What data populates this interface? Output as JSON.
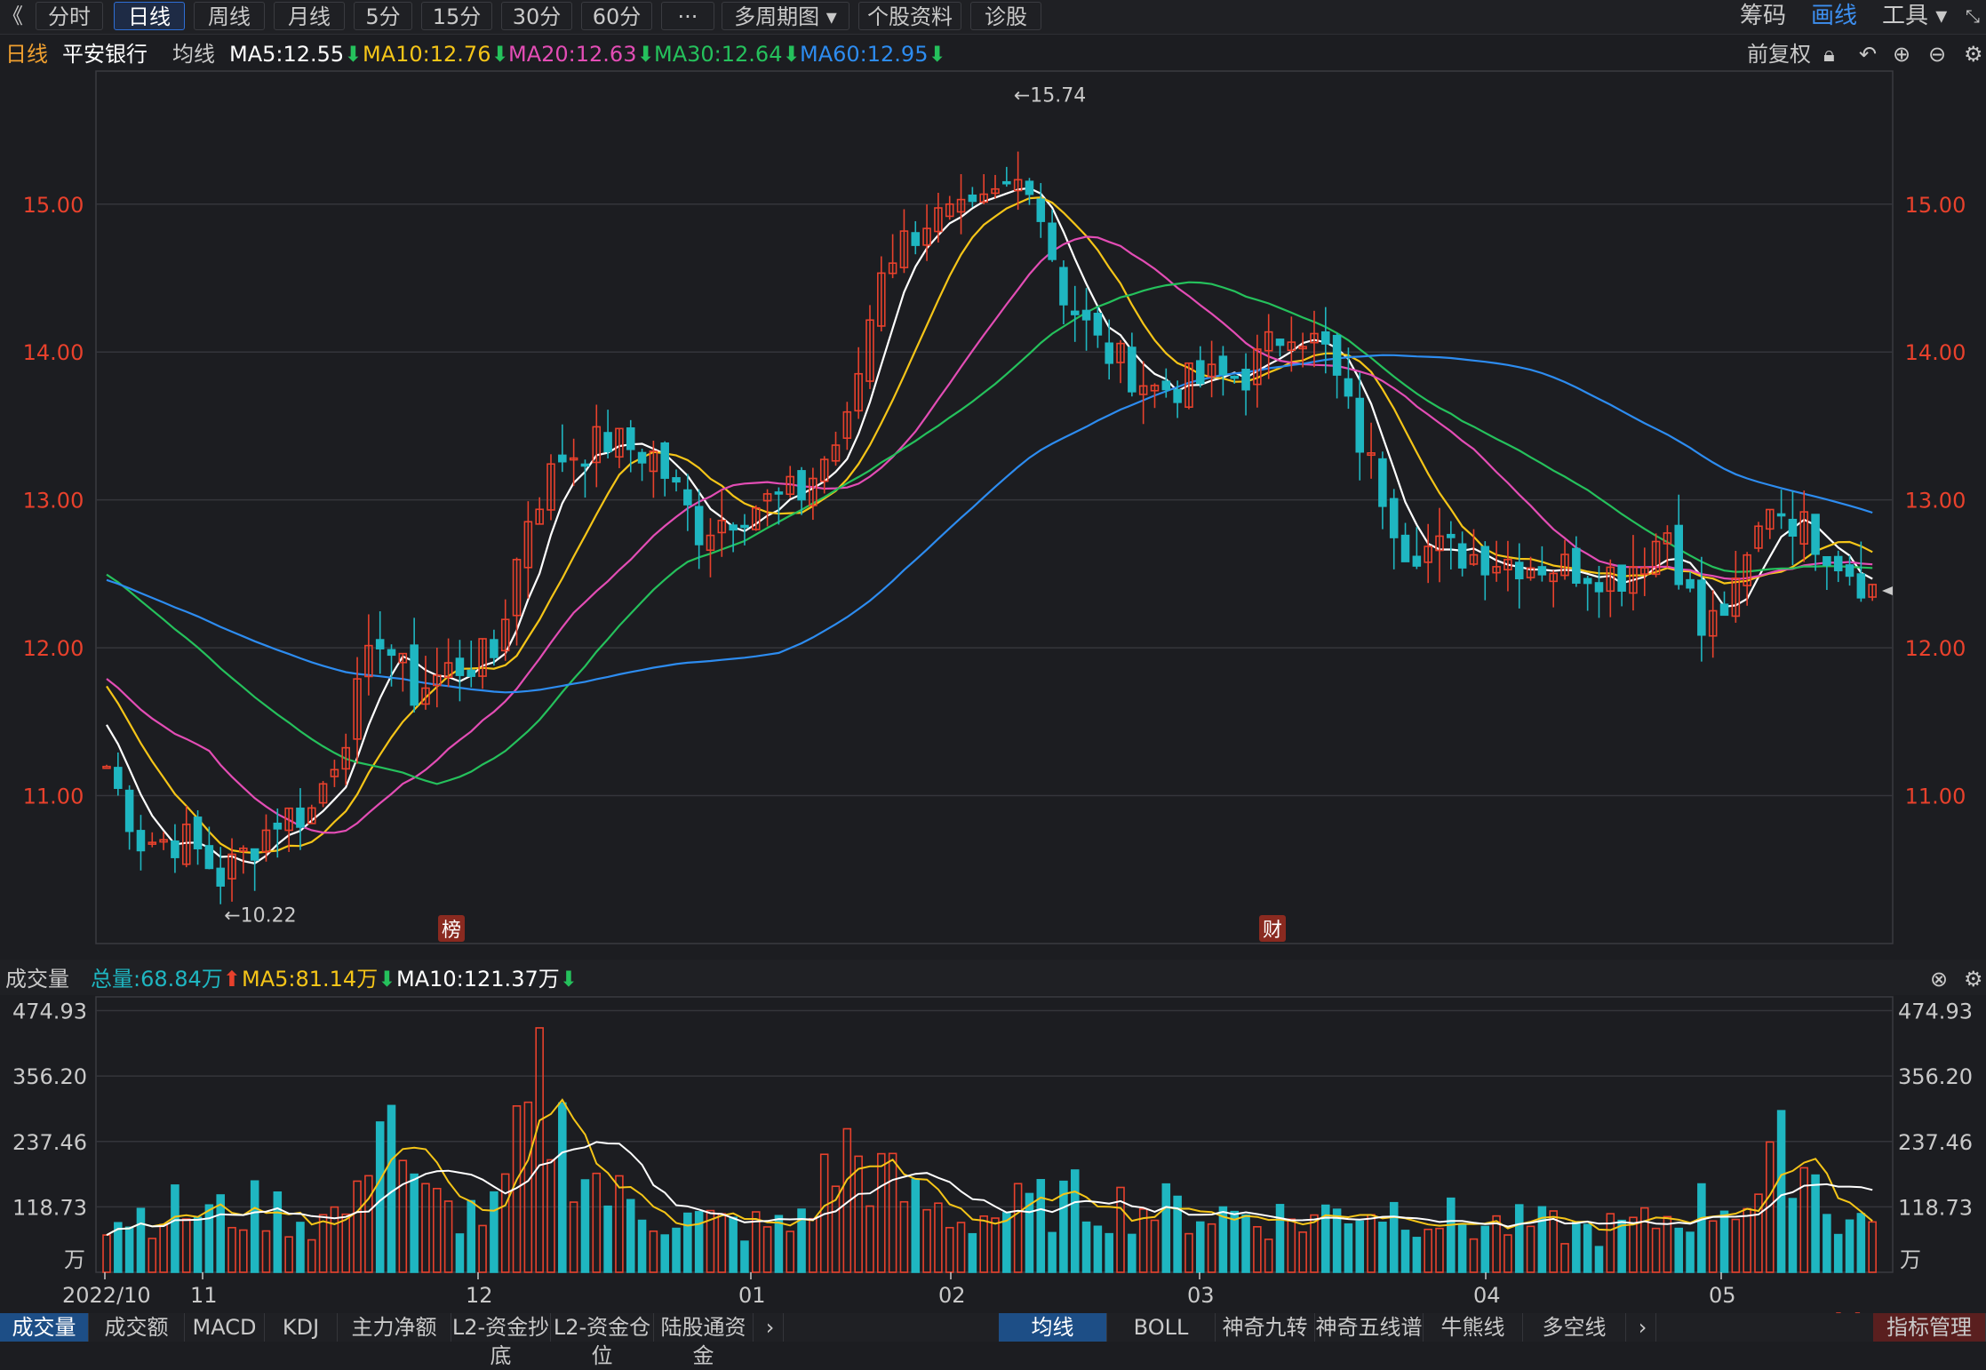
{
  "toolbar": {
    "back_glyph": "《",
    "buttons": [
      "分时",
      "日线",
      "周线",
      "月线",
      "5分",
      "15分",
      "30分",
      "60分",
      "···",
      "多周期图 ▾",
      "个股资料",
      "诊股"
    ],
    "active_index": 1,
    "right": [
      {
        "label": "筹码",
        "color": "#c9c9c9"
      },
      {
        "label": "画线",
        "color": "#3d8ff0"
      },
      {
        "label": "工具 ▾",
        "color": "#c9c9c9"
      }
    ]
  },
  "info": {
    "period": "日线",
    "stock_name": "平安银行",
    "ma_label": "均线",
    "ma": [
      {
        "text": "MA5:12.55",
        "color": "#ffffff"
      },
      {
        "text": "MA10:12.76",
        "color": "#f5c518"
      },
      {
        "text": "MA20:12.63",
        "color": "#e34db5"
      },
      {
        "text": "MA30:12.64",
        "color": "#25c15c"
      },
      {
        "text": "MA60:12.95",
        "color": "#2d8cf0"
      }
    ],
    "arrow_down": "⬇",
    "restore": "前复权"
  },
  "main_axis": {
    "labels": [
      "15.00",
      "14.00",
      "13.00",
      "12.00",
      "11.00"
    ],
    "values": [
      15,
      14,
      13,
      12,
      11
    ],
    "color": "#e8412c"
  },
  "annotations": {
    "high": "←15.74",
    "low": "←10.22",
    "tag_bang": "榜",
    "tag_cai": "财"
  },
  "volume": {
    "title": "成交量",
    "total": "总量:68.84万",
    "total_arrow": "⬆",
    "ma5": "MA5:81.14万",
    "ma10": "MA10:121.37万",
    "arrow_down": "⬇",
    "axis_labels": [
      "474.93",
      "356.20",
      "237.46",
      "118.73"
    ],
    "axis_values": [
      474.93,
      356.2,
      237.46,
      118.73
    ],
    "unit": "万"
  },
  "date_axis": [
    "2022/10",
    "11",
    "12",
    "01",
    "02",
    "03",
    "04",
    "05"
  ],
  "bottom_tabs_left": [
    "成交量",
    "成交额",
    "MACD",
    "KDJ",
    "主力净额",
    "L2-资金抄底",
    "L2-资金仓位",
    "陆股通资金"
  ],
  "bottom_tabs_right": [
    "均线",
    "BOLL",
    "神奇九转",
    "神奇五线谱",
    "牛熊线",
    "多空线"
  ],
  "indicator_manage": "指标管理",
  "watermark": "www.dd...m",
  "chart_data": {
    "type": "candlestick",
    "y_range": [
      10.0,
      15.9
    ],
    "anchors_close": [
      [
        0,
        11.2
      ],
      [
        3,
        10.7
      ],
      [
        7,
        10.7
      ],
      [
        10,
        10.45
      ],
      [
        12,
        10.6
      ],
      [
        15,
        10.85
      ],
      [
        18,
        10.9
      ],
      [
        21,
        11.45
      ],
      [
        24,
        12.1
      ],
      [
        27,
        11.7
      ],
      [
        30,
        11.85
      ],
      [
        34,
        11.95
      ],
      [
        37,
        12.9
      ],
      [
        40,
        13.3
      ],
      [
        44,
        13.4
      ],
      [
        48,
        13.3
      ],
      [
        52,
        12.8
      ],
      [
        56,
        12.95
      ],
      [
        61,
        13.05
      ],
      [
        65,
        13.5
      ],
      [
        68,
        14.6
      ],
      [
        72,
        14.9
      ],
      [
        76,
        14.9
      ],
      [
        79,
        15.1
      ],
      [
        81,
        15.2
      ],
      [
        84,
        14.4
      ],
      [
        87,
        14.05
      ],
      [
        92,
        13.75
      ],
      [
        96,
        13.8
      ],
      [
        100,
        13.85
      ],
      [
        104,
        14.2
      ],
      [
        107,
        14.0
      ],
      [
        110,
        13.4
      ],
      [
        114,
        12.7
      ],
      [
        118,
        12.65
      ],
      [
        123,
        12.6
      ],
      [
        128,
        12.55
      ],
      [
        133,
        12.5
      ],
      [
        137,
        12.8
      ],
      [
        140,
        12.1
      ],
      [
        143,
        12.35
      ],
      [
        146,
        13.0
      ],
      [
        150,
        12.75
      ],
      [
        155,
        12.4
      ]
    ],
    "volume_anchors": [
      [
        0,
        95
      ],
      [
        5,
        115
      ],
      [
        10,
        105
      ],
      [
        14,
        120
      ],
      [
        18,
        90
      ],
      [
        22,
        120
      ],
      [
        24,
        380
      ],
      [
        27,
        140
      ],
      [
        30,
        110
      ],
      [
        34,
        105
      ],
      [
        38,
        320
      ],
      [
        40,
        250
      ],
      [
        44,
        140
      ],
      [
        49,
        100
      ],
      [
        55,
        85
      ],
      [
        60,
        80
      ],
      [
        65,
        220
      ],
      [
        70,
        140
      ],
      [
        75,
        95
      ],
      [
        80,
        115
      ],
      [
        85,
        130
      ],
      [
        90,
        120
      ],
      [
        95,
        110
      ],
      [
        100,
        105
      ],
      [
        105,
        95
      ],
      [
        110,
        120
      ],
      [
        115,
        110
      ],
      [
        120,
        85
      ],
      [
        125,
        85
      ],
      [
        130,
        75
      ],
      [
        135,
        85
      ],
      [
        140,
        120
      ],
      [
        145,
        140
      ],
      [
        148,
        240
      ],
      [
        152,
        100
      ],
      [
        155,
        90
      ]
    ]
  }
}
